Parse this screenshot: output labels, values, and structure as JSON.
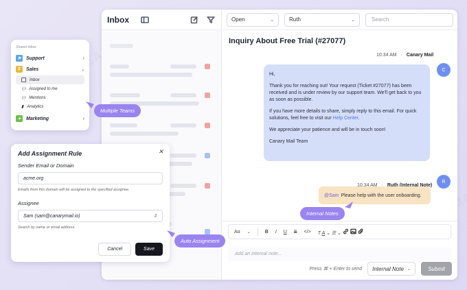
{
  "inbox_pane": {
    "title": "Inbox",
    "compose_icon": "compose-icon",
    "filter_icon": "filter-icon",
    "layout_icon": "sidebar-layout-icon"
  },
  "toolbar": {
    "status_value": "Open",
    "assignee_value": "Ruth",
    "search_placeholder": "Search"
  },
  "conversation": {
    "subject": "Inquiry About Free Trial (#27077)",
    "message": {
      "time": "10:34 AM",
      "sender": "Canary Mail",
      "avatar_initial": "C",
      "greeting": "Hi,",
      "para1": "Thank you for reaching out! Your request (Ticket #27077) has been received and is under review by our support team. We'll get back to you as soon as possible.",
      "para2_prefix": "If you have more details to share, simply reply to this email. For quick solutions, feel free to visit our ",
      "para2_link": "Help Center",
      "para2_suffix": ".",
      "para3": "We appreciate your patience and will be in touch soon!",
      "signature": "Canary Mail Team"
    },
    "note": {
      "time": "10:34 AM",
      "sender": "Ruth (Internal Note)",
      "avatar_initial": "R",
      "mention": "@Sam",
      "text": "Please help with the user onboarding."
    }
  },
  "editor": {
    "font_label": "Aα",
    "placeholder": "Add an internal note...",
    "send_hint": "Press ⌘ + Enter to send",
    "mode_value": "Internal Note",
    "submit_label": "Submit"
  },
  "teams_card": {
    "header": "Shared Inbox",
    "teams": [
      {
        "label": "Support",
        "color": "#5aa8e6"
      },
      {
        "label": "Sales",
        "color": "#e8b73c"
      },
      {
        "label": "Marketing",
        "color": "#6cc04a"
      }
    ],
    "sub_items": [
      "Inbox",
      "Assigned to me",
      "Mentions",
      "Analytics"
    ]
  },
  "rule_card": {
    "title": "Add Assignment Rule",
    "sender_label": "Sender Email or Domain",
    "sender_value": "acme.org",
    "sender_help": "Emails from this domain will be assigned to the specified assignee.",
    "assignee_label": "Assignee",
    "assignee_value": "Sam (sam@canarymail.io)",
    "assignee_help": "Search by name or email address.",
    "cancel_label": "Cancel",
    "save_label": "Save"
  },
  "callouts": {
    "multiple_teams": "Multiple Teams",
    "auto_assignment": "Auto Assignment",
    "internal_notes": "Internal Notes"
  },
  "watermark_text": "CLEAN.EMAIL",
  "colors": {
    "accent": "#9a84f0",
    "message_bubble": "#d5def9",
    "note_bubble": "#f8e3c3",
    "link": "#4f76e6"
  }
}
